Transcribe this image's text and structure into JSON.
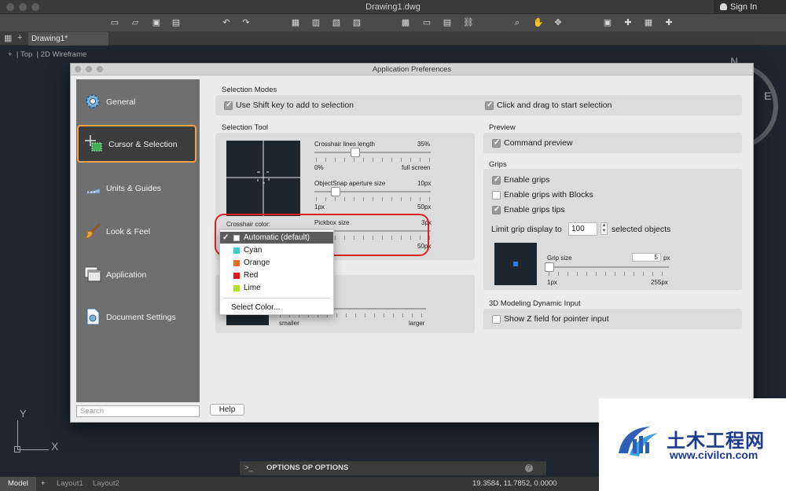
{
  "window": {
    "title": "Drawing1.dwg",
    "sign_in": "Sign In",
    "tab": "Drawing1*",
    "view_labels": [
      "+",
      "Top",
      "2D Wireframe"
    ],
    "compass_n": "N",
    "compass_e": "E",
    "ucs_y": "Y",
    "ucs_x": "X"
  },
  "command_line": {
    "prompt": ">_",
    "text": "OPTIONS OP OPTIONS",
    "help": "?"
  },
  "status_bar": {
    "tabs": [
      "Model",
      "Layout1",
      "Layout2"
    ],
    "coords": "19.3584, 11.7852, 0.0000"
  },
  "dialog": {
    "title": "Application Preferences",
    "sidebar": [
      {
        "label": "General",
        "icon": "gear-icon"
      },
      {
        "label": "Cursor & Selection",
        "icon": "cursor-selection-icon"
      },
      {
        "label": "Units & Guides",
        "icon": "ruler-icon"
      },
      {
        "label": "Look & Feel",
        "icon": "brush-icon"
      },
      {
        "label": "Application",
        "icon": "window-icon"
      },
      {
        "label": "Document Settings",
        "icon": "document-settings-icon"
      }
    ],
    "search_placeholder": "Search",
    "help_button": "Help",
    "selection_modes": {
      "label": "Selection Modes",
      "shift_add": "Use Shift key to add to selection",
      "click_drag": "Click and drag to start selection"
    },
    "selection_tool": {
      "label": "Selection Tool",
      "crosshair_length": {
        "label": "Crosshair lines length",
        "value": "35%",
        "min": "0%",
        "max": "full screen",
        "fraction": 0.35
      },
      "osnap_aperture": {
        "label": "ObjectSnap aperture size",
        "value": "10px",
        "min": "1px",
        "max": "50px",
        "fraction": 0.18
      },
      "pickbox": {
        "label": "Pickbox size",
        "value": "3px",
        "max": "50px"
      },
      "crosshair_color_label": "Crosshair color:"
    },
    "pickbox_panel": {
      "smaller": "smaller",
      "larger": "larger"
    },
    "preview": {
      "label": "Preview",
      "command_preview": "Command preview"
    },
    "grips": {
      "label": "Grips",
      "enable_grips": "Enable grips",
      "enable_blocks": "Enable grips with Blocks",
      "enable_tips": "Enable grips tips",
      "limit_label": "Limit grip display to",
      "limit_value": "100",
      "limit_suffix": "selected objects",
      "grip_size": {
        "label": "Grip size",
        "value": "5",
        "unit": "px",
        "min": "1px",
        "max": "255px",
        "fraction": 0.02
      }
    },
    "modeling": {
      "label": "3D Modeling Dynamic Input",
      "show_z": "Show Z field for pointer input"
    },
    "crosshair_dropdown": {
      "items": [
        {
          "label": "Automatic (default)",
          "color": "#ffffff",
          "checked": true
        },
        {
          "label": "Cyan",
          "color": "#33d1d1"
        },
        {
          "label": "Orange",
          "color": "#ef6a1a"
        },
        {
          "label": "Red",
          "color": "#e8141b"
        },
        {
          "label": "Lime",
          "color": "#b5e01a"
        }
      ],
      "select_color": "Select Color..."
    }
  },
  "watermark": {
    "name": "土木工程网",
    "url": "www.civilcn.com"
  },
  "colors": {
    "accent_orange": "#f0a34a",
    "annotation_red": "#e02020",
    "sidebar_bg": "#6f6f6f",
    "canvas_bg": "#1f262f"
  }
}
